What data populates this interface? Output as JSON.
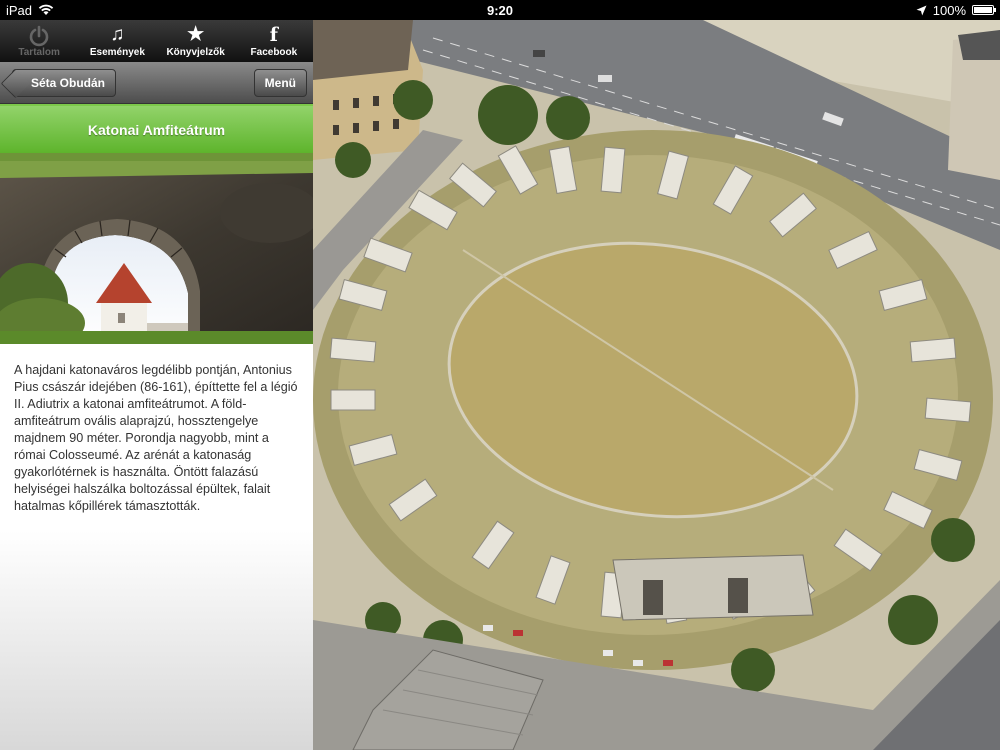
{
  "status_bar": {
    "device": "iPad",
    "time": "9:20",
    "battery": "100%",
    "battery_level": 1.0,
    "icons": [
      "wifi-icon",
      "location-arrow-icon",
      "battery-icon"
    ]
  },
  "tabs": [
    {
      "label": "Tartalom",
      "icon": "power-icon",
      "enabled": false
    },
    {
      "label": "Események",
      "icon": "music-notes-icon",
      "enabled": true
    },
    {
      "label": "Könyvjelzők",
      "icon": "star-icon",
      "enabled": true
    },
    {
      "label": "Facebook",
      "icon": "facebook-icon",
      "enabled": true
    }
  ],
  "nav": {
    "back_label": "Séta Obudán",
    "menu_label": "Menü"
  },
  "section_title": "Katonai Amfiteátrum",
  "description": "A hajdani katonaváros legdélibb pontján, Antonius Pius császár idejében (86-161), építtette fel a légió II. Adiutrix a katonai amfiteátrumot. A föld-amfiteátrum ovális alaprajzú, hossztengelye majdnem 90 méter. Porondja nagyobb, mint a római Colosseumé. Az arénát a katonaság gyakorlótérnek is használta. Öntött falazású helyiségei halszálka boltozással épültek, falait hatalmas kőpillérek támasztották.",
  "colors": {
    "title_band": "#6cbf3b",
    "nav_bar": "#6a6a6a",
    "tab_bar": "#1c1c1c"
  }
}
